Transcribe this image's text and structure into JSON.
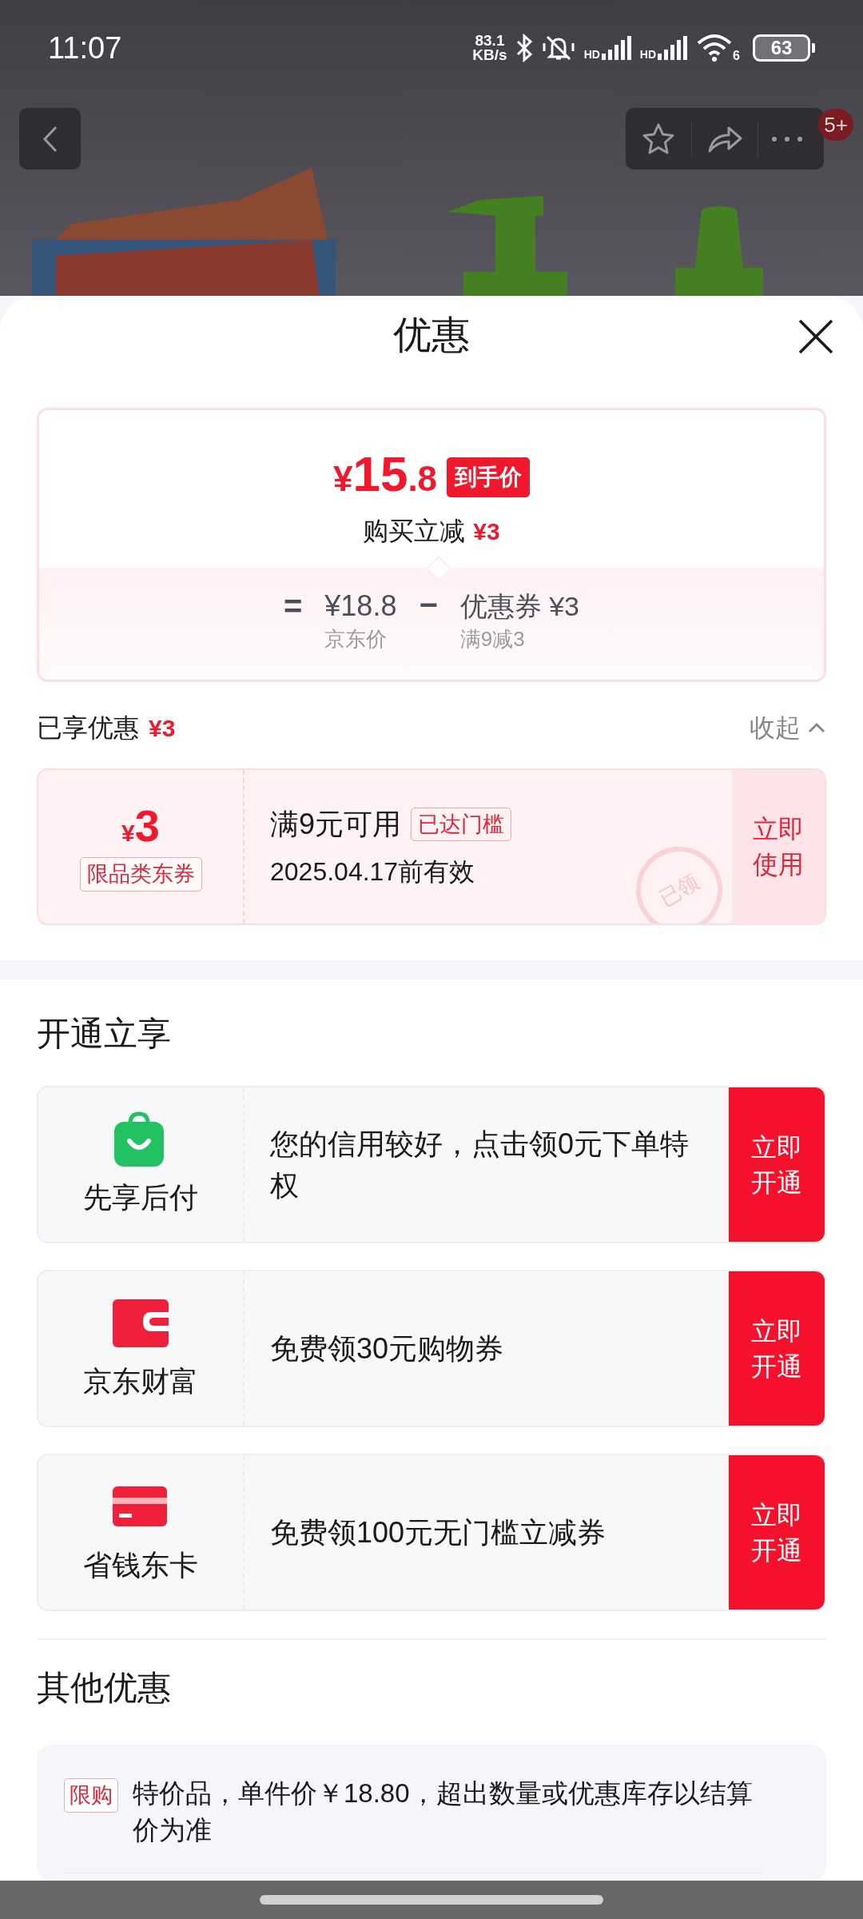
{
  "status_bar": {
    "time": "11:07",
    "speed_value": "83.1",
    "speed_unit": "KB/s",
    "sim_labels": [
      "HD",
      "HD"
    ],
    "wifi_label": "6",
    "battery": "63"
  },
  "header": {
    "badge": "5+"
  },
  "sheet": {
    "title": "优惠"
  },
  "price_card": {
    "currency": "¥",
    "price_main": "15",
    "price_fraction": ".8",
    "price_tag": "到手价",
    "saving_label": "购买立减",
    "saving_amount": "¥3",
    "equals": "=",
    "base_price": "¥18.8",
    "base_label": "京东价",
    "minus": "−",
    "coupon_value": "优惠券 ¥3",
    "coupon_rule": "满9减3"
  },
  "enjoyed": {
    "label": "已享优惠",
    "amount": "¥3",
    "toggle": "收起",
    "expanded": true
  },
  "coupon": {
    "currency": "¥",
    "amount": "3",
    "tag": "限品类东券",
    "condition": "满9元可用",
    "threshold_badge": "已达门槛",
    "validity": "2025.04.17前有效",
    "stamp": "已领",
    "button": "立即使用"
  },
  "open_section": {
    "title": "开通立享",
    "offers": [
      {
        "kind": "bag",
        "name": "先享后付",
        "description": "您的信用较好，点击领0元下单特权",
        "button": "立即开通"
      },
      {
        "kind": "wallet",
        "name": "京东财富",
        "description": "免费领30元购物券",
        "button": "立即开通"
      },
      {
        "kind": "card",
        "name": "省钱东卡",
        "description": "免费领100元无门槛立减券",
        "button": "立即开通"
      }
    ]
  },
  "other_section": {
    "title": "其他优惠",
    "items": [
      {
        "tag": "限购",
        "text": "特价品，单件价￥18.80，超出数量或优惠库存以结算价为准"
      }
    ]
  }
}
